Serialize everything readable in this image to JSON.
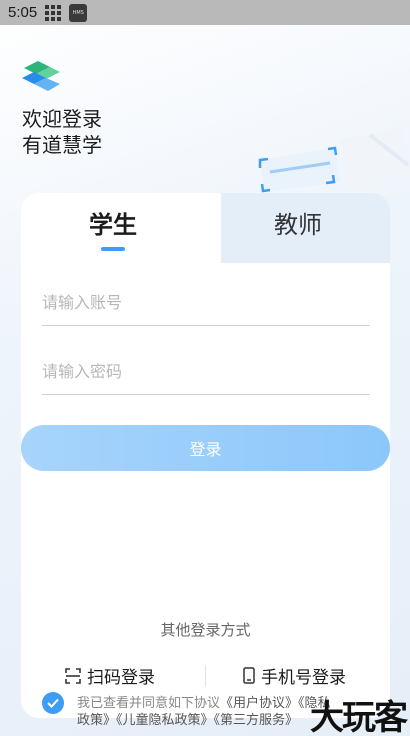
{
  "status_bar": {
    "time": "5:05",
    "grid_icon": "app-grid-icon",
    "hms_icon": "hms-icon",
    "hms_text": "HMS"
  },
  "header": {
    "welcome_line1": "欢迎登录",
    "welcome_line2": "有道慧学"
  },
  "tabs": [
    {
      "label": "学生",
      "active": true
    },
    {
      "label": "教师",
      "active": false
    }
  ],
  "form": {
    "account_placeholder": "请输入账号",
    "password_placeholder": "请输入密码",
    "login_label": "登录"
  },
  "other_login": {
    "title": "其他登录方式",
    "qr_label": "扫码登录",
    "phone_label": "手机号登录"
  },
  "agreement": {
    "prefix": "我已查看并同意如下协议",
    "user_agreement": "《用户协议》",
    "privacy_short": "《隐私",
    "line2": "政策》《儿童隐私政策》《第三方服务》"
  },
  "watermark": "大玩客",
  "colors": {
    "accent": "#3d9df3",
    "login_button": "#9dcefb",
    "tab_inactive_bg": "#e4eef9"
  }
}
